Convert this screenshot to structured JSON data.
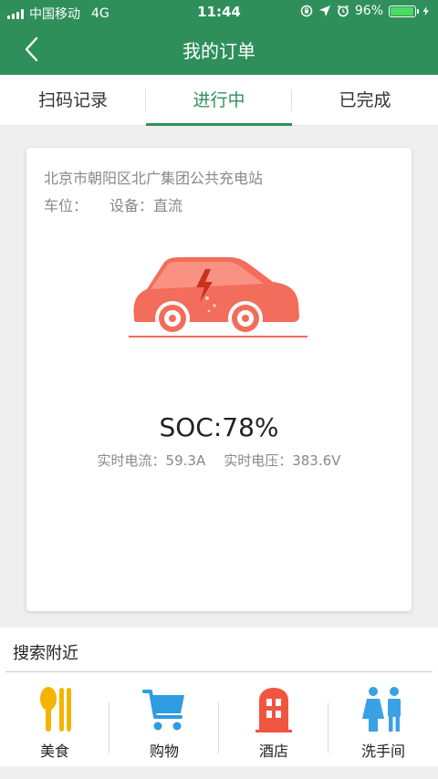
{
  "status_bar": {
    "carrier": "中国移动",
    "network": "4G",
    "time": "11:44",
    "battery": "96%",
    "battery_level": 0.96,
    "icons": [
      "rotation-lock-icon",
      "location-arrow-icon",
      "alarm-icon",
      "charging-bolt-icon"
    ]
  },
  "nav": {
    "title": "我的订单",
    "back_icon": "chevron-left-icon"
  },
  "tabs": [
    {
      "label": "扫码记录",
      "active": false
    },
    {
      "label": "进行中",
      "active": true
    },
    {
      "label": "已完成",
      "active": false
    }
  ],
  "order": {
    "station": "北京市朝阳区北广集团公共充电站",
    "slot_label": "车位：",
    "device_label": "设备：直流",
    "car_icon": "charging-car-icon",
    "soc": "SOC:78%",
    "current": "实时电流：59.3A",
    "voltage": "实时电压：383.6V"
  },
  "nearby": {
    "title": "搜索附近",
    "items": [
      {
        "label": "美食",
        "icon": "fork-knife-icon"
      },
      {
        "label": "购物",
        "icon": "shopping-cart-icon"
      },
      {
        "label": "酒店",
        "icon": "hotel-door-icon"
      },
      {
        "label": "洗手间",
        "icon": "restroom-icon"
      }
    ]
  },
  "colors": {
    "brand_green": "#2f8f5b",
    "car_coral": "#f26d5b",
    "food_yellow": "#f5b400",
    "cart_blue": "#2f9be0",
    "hotel_red": "#f0553f",
    "restroom_blue": "#3aa1e5"
  }
}
